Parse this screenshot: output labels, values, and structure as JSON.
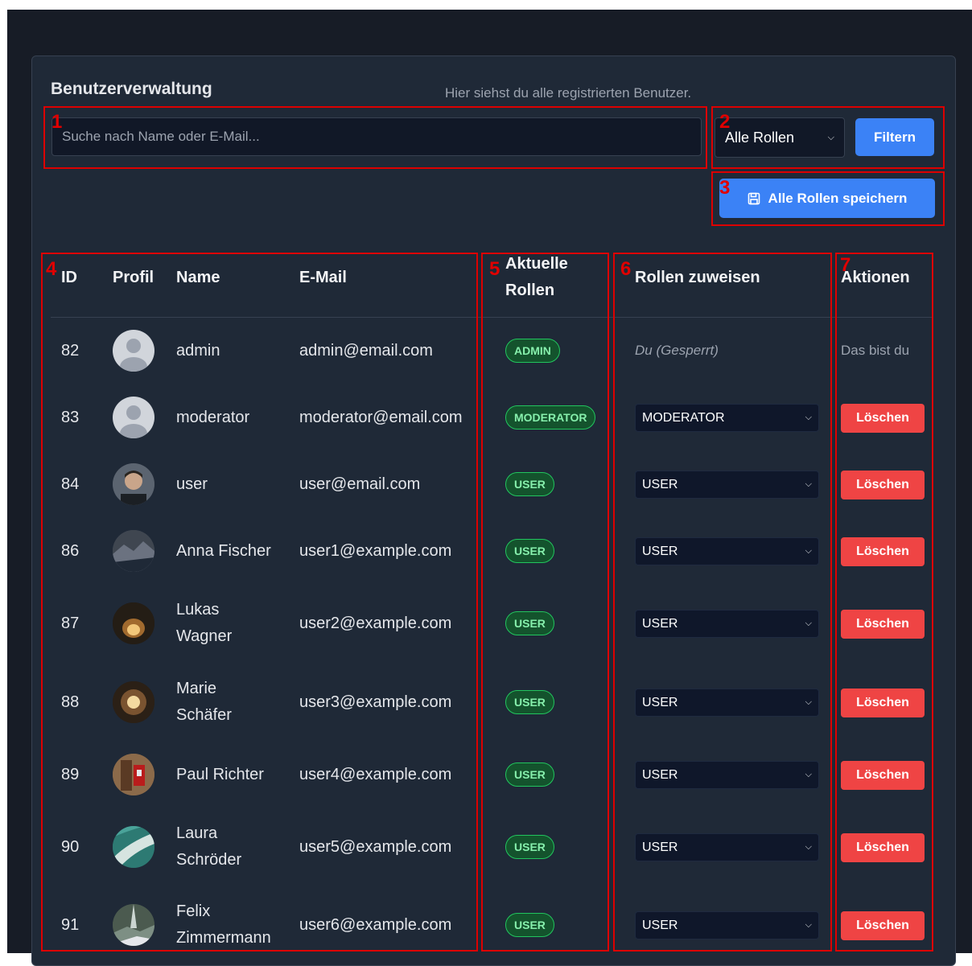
{
  "header": {
    "title": "Benutzerverwaltung",
    "subtitle": "Hier siehst du alle registrierten Benutzer."
  },
  "search": {
    "placeholder": "Suche nach Name oder E-Mail..."
  },
  "filter": {
    "selected": "Alle Rollen",
    "button": "Filtern"
  },
  "save_all": {
    "label": "Alle Rollen speichern",
    "icon": "save-icon"
  },
  "table": {
    "columns": {
      "id": "ID",
      "profile": "Profil",
      "name": "Name",
      "email": "E-Mail",
      "current_roles_1": "Aktuelle",
      "current_roles_2": "Rollen",
      "assign_roles": "Rollen zuweisen",
      "actions": "Aktionen"
    },
    "rows": [
      {
        "id": "82",
        "name1": "admin",
        "name2": "",
        "email": "admin@email.com",
        "badge": "ADMIN",
        "assign": "Du (Gesperrt)",
        "action": "Das bist du"
      },
      {
        "id": "83",
        "name1": "moderator",
        "name2": "",
        "email": "moderator@email.com",
        "badge": "MODERATOR",
        "assign": "MODERATOR",
        "action": "Löschen"
      },
      {
        "id": "84",
        "name1": "user",
        "name2": "",
        "email": "user@email.com",
        "badge": "USER",
        "assign": "USER",
        "action": "Löschen"
      },
      {
        "id": "86",
        "name1": "Anna Fischer",
        "name2": "",
        "email": "user1@example.com",
        "badge": "USER",
        "assign": "USER",
        "action": "Löschen"
      },
      {
        "id": "87",
        "name1": "Lukas",
        "name2": "Wagner",
        "email": "user2@example.com",
        "badge": "USER",
        "assign": "USER",
        "action": "Löschen"
      },
      {
        "id": "88",
        "name1": "Marie",
        "name2": "Schäfer",
        "email": "user3@example.com",
        "badge": "USER",
        "assign": "USER",
        "action": "Löschen"
      },
      {
        "id": "89",
        "name1": "Paul Richter",
        "name2": "",
        "email": "user4@example.com",
        "badge": "USER",
        "assign": "USER",
        "action": "Löschen"
      },
      {
        "id": "90",
        "name1": "Laura",
        "name2": "Schröder",
        "email": "user5@example.com",
        "badge": "USER",
        "assign": "USER",
        "action": "Löschen"
      },
      {
        "id": "91",
        "name1": "Felix",
        "name2": "Zimmermann",
        "email": "user6@example.com",
        "badge": "USER",
        "assign": "USER",
        "action": "Löschen"
      }
    ]
  },
  "annotations": [
    "1",
    "2",
    "3",
    "4",
    "5",
    "6",
    "7"
  ],
  "colors": {
    "accent": "#3b82f6",
    "danger": "#ef4444",
    "badge_bg": "#14532d",
    "badge_text": "#86efac",
    "annotation": "#dd0000"
  }
}
